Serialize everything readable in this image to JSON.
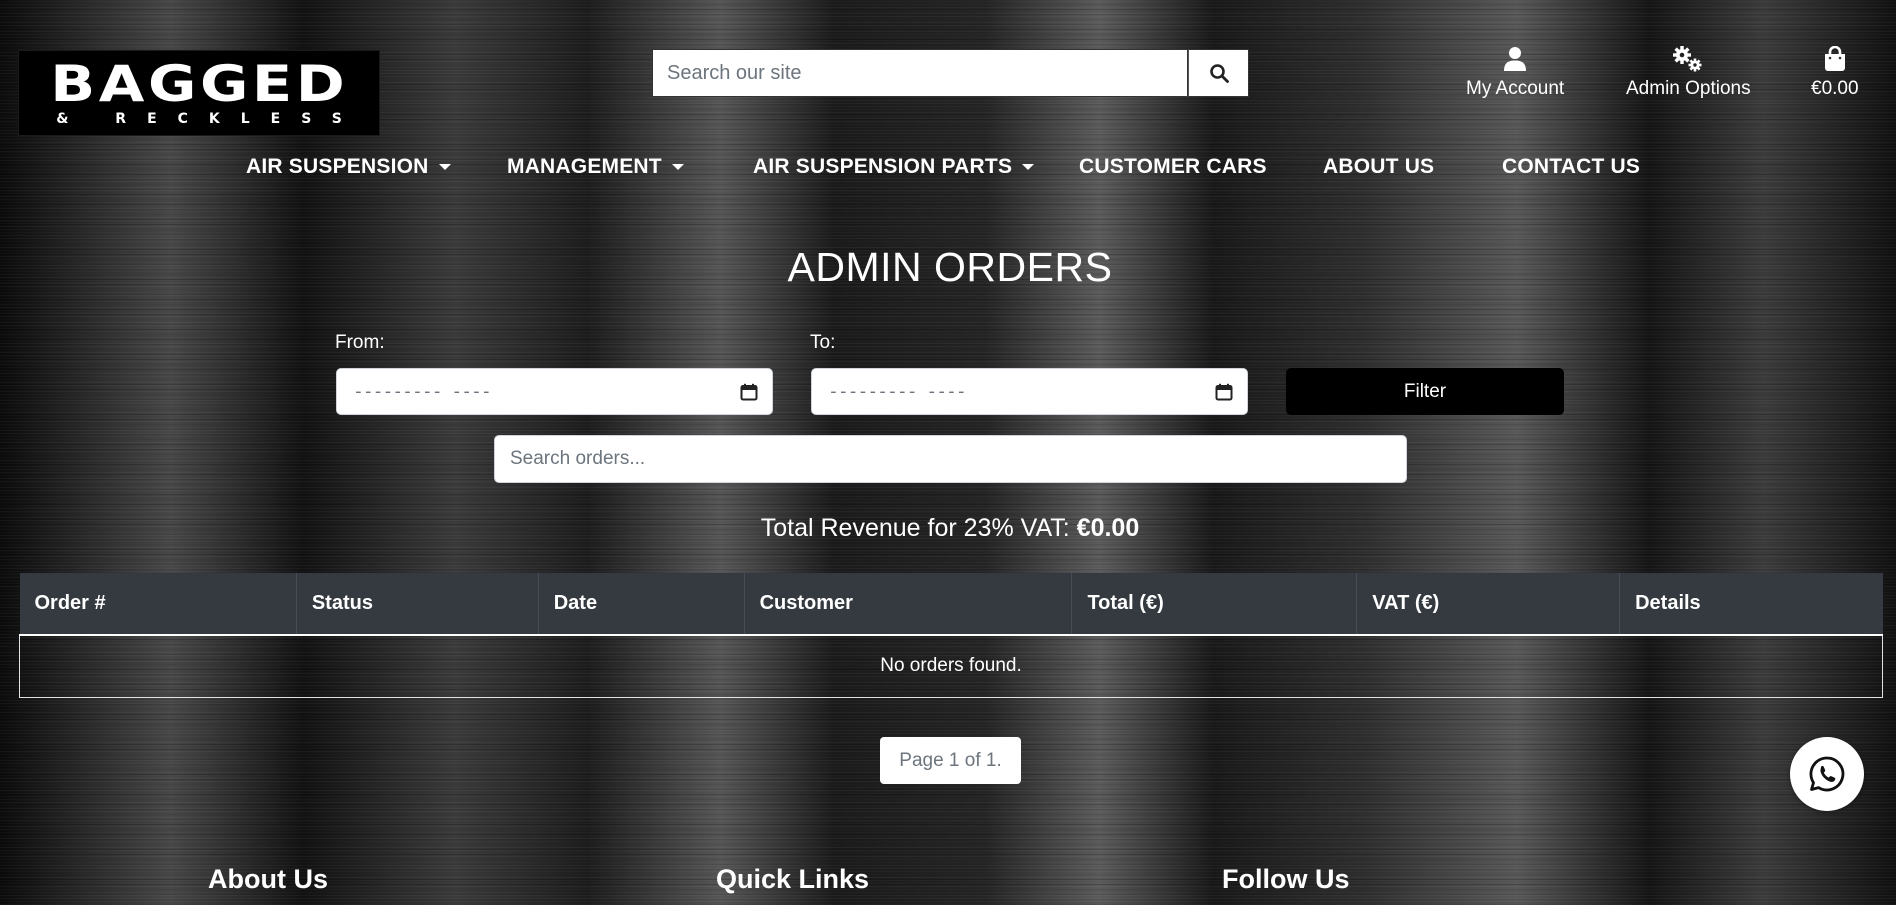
{
  "header": {
    "logo": {
      "main": "BAGGED",
      "sub": "& RECKLESS"
    },
    "search": {
      "placeholder": "Search our site"
    },
    "actions": {
      "account": "My Account",
      "admin": "Admin Options",
      "cart": "€0.00"
    }
  },
  "nav": {
    "items": [
      {
        "label": "AIR SUSPENSION",
        "dropdown": true
      },
      {
        "label": "MANAGEMENT",
        "dropdown": true
      },
      {
        "label": "AIR SUSPENSION PARTS",
        "dropdown": true
      },
      {
        "label": "CUSTOMER CARS",
        "dropdown": false
      },
      {
        "label": "ABOUT US",
        "dropdown": false
      },
      {
        "label": "CONTACT US",
        "dropdown": false
      }
    ]
  },
  "page": {
    "title": "ADMIN ORDERS",
    "filters": {
      "from_label": "From:",
      "to_label": "To:",
      "date_mask": "--------- ----",
      "filter_button": "Filter",
      "search_placeholder": "Search orders..."
    },
    "revenue": {
      "label": "Total Revenue for 23% VAT:",
      "value": "€0.00"
    },
    "table": {
      "headers": [
        "Order #",
        "Status",
        "Date",
        "Customer",
        "Total (€)",
        "VAT (€)",
        "Details"
      ],
      "empty_message": "No orders found."
    },
    "pagination": "Page 1 of 1."
  },
  "footer": {
    "headings": [
      "About Us",
      "Quick Links",
      "Follow Us"
    ]
  },
  "icons": {
    "search": "search-icon",
    "account": "user-icon",
    "admin": "gears-icon",
    "cart": "shopping-bag-icon",
    "calendar": "calendar-icon",
    "whatsapp": "whatsapp-icon"
  },
  "colors": {
    "table_header": "#343a40",
    "filter_button": "#000000",
    "text": "#ffffff"
  }
}
